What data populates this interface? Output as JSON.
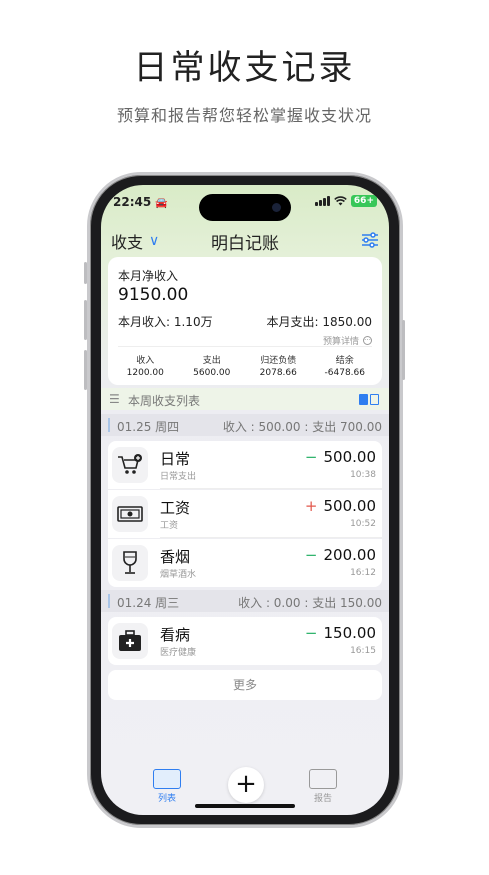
{
  "hero": {
    "title": "日常收支记录",
    "subtitle": "预算和报告帮您轻松掌握收支状况"
  },
  "status": {
    "time": "22:45",
    "car": "🚘",
    "battery": "66+"
  },
  "nav": {
    "filter_label": "收支",
    "chevron": "∨",
    "title": "明白记账",
    "settings_icon": "sliders-icon"
  },
  "summary": {
    "net_label": "本月净收入",
    "net_value": "9150.00",
    "income_label": "本月收入: 1.10万",
    "expense_label": "本月支出: 1850.00",
    "budget_link": "预算详情",
    "stats": [
      {
        "key": "收入",
        "value": "1200.00"
      },
      {
        "key": "支出",
        "value": "5600.00"
      },
      {
        "key": "归还负债",
        "value": "2078.66"
      },
      {
        "key": "结余",
        "value": "-6478.66"
      }
    ]
  },
  "list": {
    "section_title": "本周收支列表",
    "days": [
      {
        "date": "01.25 周四",
        "summary": "收入 : 500.00 : 支出 700.00",
        "items": [
          {
            "name": "日常",
            "sub": "日常支出",
            "sign": "−",
            "amount": "500.00",
            "time": "10:38",
            "icon": "shopping-cart-icon"
          },
          {
            "name": "工资",
            "sub": "工资",
            "sign": "+",
            "amount": "500.00",
            "time": "10:52",
            "icon": "cash-icon"
          },
          {
            "name": "香烟",
            "sub": "烟草酒水",
            "sign": "−",
            "amount": "200.00",
            "time": "16:12",
            "icon": "wine-glass-icon"
          }
        ]
      },
      {
        "date": "01.24 周三",
        "summary": "收入 : 0.00 : 支出 150.00",
        "items": [
          {
            "name": "看病",
            "sub": "医疗健康",
            "sign": "−",
            "amount": "150.00",
            "time": "16:15",
            "icon": "medical-kit-icon"
          }
        ]
      }
    ],
    "more_label": "更多"
  },
  "tabbar": {
    "list_label": "列表",
    "add_label": "+",
    "report_label": "报告"
  },
  "colors": {
    "accent": "#2f7ef0",
    "income": "#e2574c",
    "expense": "#2db36b"
  }
}
